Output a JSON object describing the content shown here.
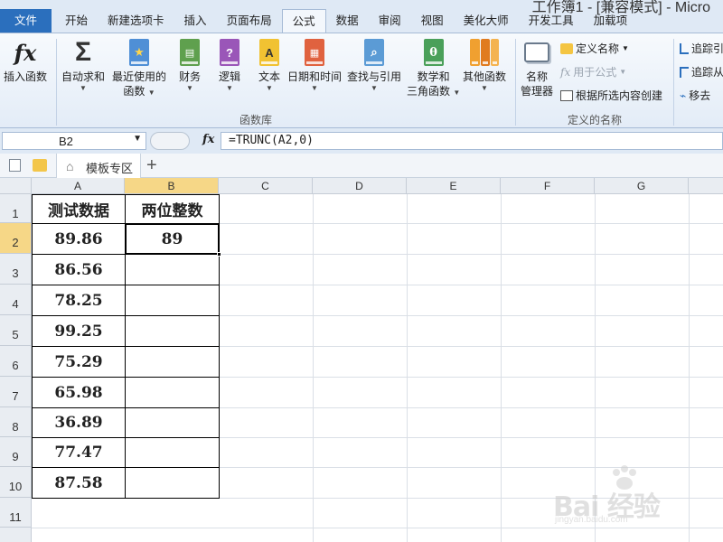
{
  "window": {
    "title": "工作簿1 - [兼容模式] - Micro"
  },
  "tabs": [
    {
      "label": "文件"
    },
    {
      "label": "开始"
    },
    {
      "label": "新建选项卡"
    },
    {
      "label": "插入"
    },
    {
      "label": "页面布局"
    },
    {
      "label": "公式"
    },
    {
      "label": "数据"
    },
    {
      "label": "审阅"
    },
    {
      "label": "视图"
    },
    {
      "label": "美化大师"
    },
    {
      "label": "开发工具"
    },
    {
      "label": "加载项"
    }
  ],
  "active_tab": "公式",
  "ribbon": {
    "insert_function": {
      "icon": "fx",
      "label": "插入函数"
    },
    "autosum": {
      "icon": "Σ",
      "label": "自动求和"
    },
    "recent": {
      "label1": "最近使用的",
      "label2": "函数"
    },
    "finance": {
      "label": "财务"
    },
    "logic": {
      "label": "逻辑",
      "glyph": "?"
    },
    "text": {
      "label": "文本",
      "glyph": "A"
    },
    "datetime": {
      "label": "日期和时间"
    },
    "lookup": {
      "label": "查找与引用"
    },
    "math": {
      "label1": "数学和",
      "label2": "三角函数",
      "glyph": "θ"
    },
    "other": {
      "label": "其他函数"
    },
    "group_library": "函数库",
    "name_manager": {
      "label1": "名称",
      "label2": "管理器"
    },
    "define_name": "定义名称",
    "use_in_formula": "用于公式",
    "create_from_selection": "根据所选内容创建",
    "group_names": "定义的名称",
    "trace_precedents": "追踪引",
    "trace_dependents": "追踪从",
    "remove_arrows": "移去"
  },
  "formula_bar": {
    "name_box": "B2",
    "fx_label": "fx",
    "formula": "=TRUNC(A2,0)"
  },
  "workbook_strip": {
    "template_tab": "模板专区",
    "add_button": "+"
  },
  "sheet": {
    "columns": [
      "A",
      "B",
      "C",
      "D",
      "E",
      "F",
      "G"
    ],
    "rows": [
      "1",
      "2",
      "3",
      "4",
      "5",
      "6",
      "7",
      "8",
      "9",
      "10",
      "11"
    ],
    "selected_cell": "B2",
    "header_A1": "测试数据",
    "header_B1": "两位整数",
    "col_a_values": [
      "89.86",
      "86.56",
      "78.25",
      "99.25",
      "75.29",
      "65.98",
      "36.89",
      "77.47",
      "87.58"
    ],
    "col_b_values": [
      "89",
      "",
      "",
      "",
      "",
      "",
      "",
      "",
      ""
    ]
  },
  "watermark": {
    "logo": "Bai 经验",
    "url": "jingyan.baidu.com"
  }
}
